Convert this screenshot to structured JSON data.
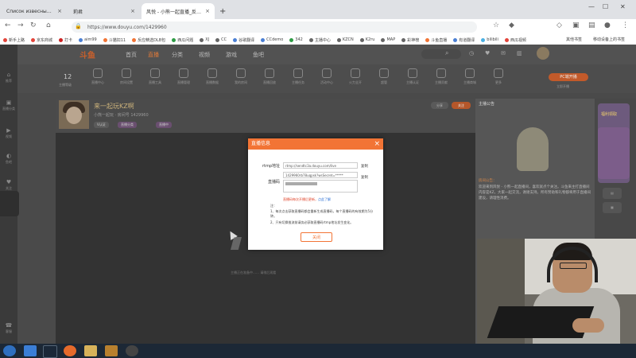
{
  "browser": {
    "tabs": [
      {
        "label": "Список извесных нам карт...",
        "active": false
      },
      {
        "label": "莉君",
        "active": false
      },
      {
        "label": "风悦 - 小熊一起直播_反应精选",
        "active": true
      }
    ],
    "url": "https://www.douyu.com/1429960",
    "bookmarks": [
      "新手上路",
      "京东商城",
      "打卡",
      "aim99",
      "斗猫扣11",
      "反应精选DLB包",
      "西瓜问题",
      "XJ",
      "CC",
      "谷歌翻译",
      "CCdemo",
      "342",
      "主播中心",
      "KZCN",
      "K2ru",
      "MAP",
      "彩神榜",
      "斗鱼直播",
      "有道翻译",
      "bilibili",
      "西瓜视频"
    ],
    "bookmark_more": "移动设备上的书签",
    "bookmark_folder": "其他书签"
  },
  "site": {
    "logo": "斗鱼",
    "nav": [
      {
        "label": "首页",
        "active": false
      },
      {
        "label": "直播",
        "active": true
      },
      {
        "label": "分类",
        "active": false
      },
      {
        "label": "视频",
        "active": false
      },
      {
        "label": "游戏",
        "active": false
      },
      {
        "label": "鱼吧",
        "active": false
      }
    ],
    "left_nav": [
      {
        "icon": "home-icon",
        "label": "推荐"
      },
      {
        "icon": "live-icon",
        "label": "直播分类"
      },
      {
        "icon": "video-icon",
        "label": "视频"
      },
      {
        "icon": "fish-icon",
        "label": "鱼吧"
      },
      {
        "icon": "follow-icon",
        "label": "关注"
      }
    ],
    "left_bottom_label": "客服",
    "level_number": "12",
    "level_label": "主播等级",
    "func_items": [
      "直播中心",
      "房间设置",
      "直播工具",
      "直播管理",
      "直播数据",
      "我的房间",
      "直播回放",
      "主播任务",
      "活动中心",
      "火力全开",
      "超管",
      "主播认证",
      "主播贡献",
      "主播商城",
      "更多"
    ],
    "pc_live_button": "PC端开播",
    "pc_live_sub": "立即开播",
    "room": {
      "title": "来一起玩KZ啊",
      "sub": "小熊一起玩 · 房间号 1429960",
      "tags": [
        "V认证",
        "直播分类",
        "直播中"
      ],
      "right_btn": "分享",
      "follow_btn": "关注"
    },
    "video_hint": "主播正在准备中……  请稍后观看",
    "right_panel": {
      "header": "主播公告",
      "notice_title": "房间公告：",
      "notice": "欢迎来到风悦 - 小熊一起直播间，喜欢就点个关注。斗鱼来主打直播间内容是KZ，大家一起交流，谢谢支持。所有赞助和礼物都将用于直播间建设，请理性消费。"
    },
    "promo_label": "福利领取"
  },
  "modal": {
    "title": "直播信息",
    "rtmp_label": "rtmp地址",
    "rtmp_value": "rtmp://sendtc3a.douyu.com/live",
    "code_label": "直播码",
    "code_value": "1429960rb78uqpsk?wsSecret=*****",
    "code_masked": "**********",
    "copy_label": "复制",
    "warning": "直播码每次开播后更新，",
    "warning_link": "点此了解",
    "note_title": "注：",
    "notes": [
      "1、每次点击获取直播码都会重新生成直播码，每个直播码的有效期为5分钟。",
      "2、只有切换推流前请务必获取直播码rtmp地址发生变化。"
    ],
    "close_button": "关闭"
  },
  "taskbar": {
    "icons": [
      "start-icon",
      "chrome-icon",
      "steam-icon",
      "firefox-icon",
      "explorer-icon",
      "cs-icon",
      "obs-icon"
    ]
  }
}
